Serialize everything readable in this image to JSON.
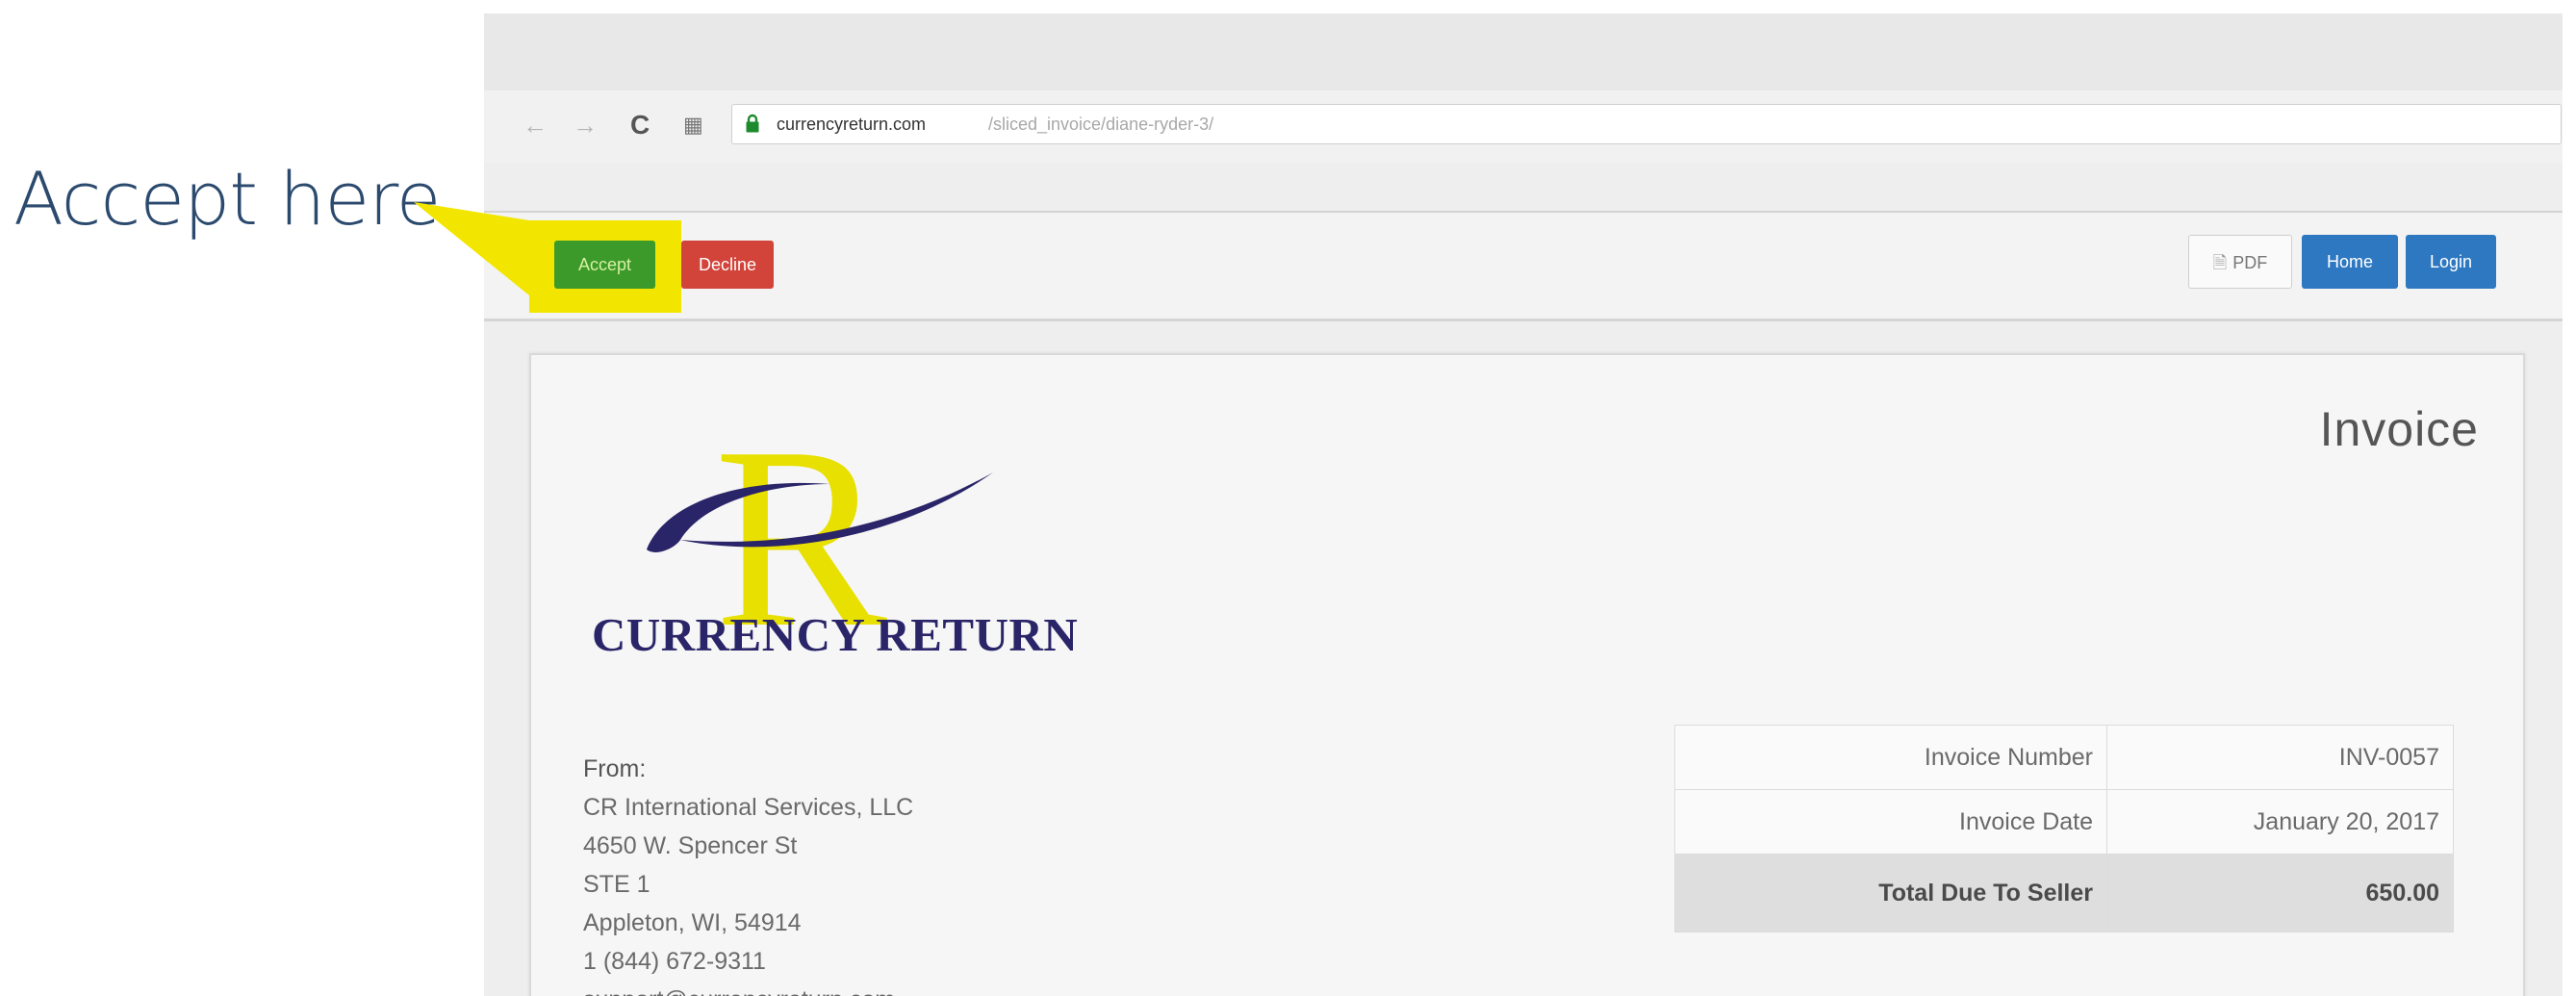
{
  "callout": {
    "text": "Accept here",
    "color": "#f2e600"
  },
  "browser": {
    "nav": {
      "back_icon": "back-arrow-icon",
      "forward_icon": "forward-arrow-icon",
      "reload_icon": "reload-icon",
      "apps_icon": "apps-grid-icon",
      "secure_icon": "lock-icon"
    },
    "url": {
      "host": "currencyreturn.com",
      "path": "/sliced_invoice/diane-ryder-3/"
    }
  },
  "actions": {
    "accept_label": "Accept",
    "decline_label": "Decline",
    "pdf_label": "PDF",
    "home_label": "Home",
    "login_label": "Login"
  },
  "invoice": {
    "title": "Invoice",
    "logo": {
      "wordmark": "CURRENCY RETURN",
      "brand_yellow": "#e8e000",
      "brand_navy": "#2a2468"
    },
    "from": {
      "label": "From:",
      "lines": [
        "CR International Services, LLC",
        "4650 W. Spencer St",
        "STE 1",
        "Appleton, WI, 54914",
        "1 (844) 672-9311",
        "support@currencyreturn.com"
      ]
    },
    "summary": [
      {
        "label": "Invoice Number",
        "value": "INV-0057"
      },
      {
        "label": "Invoice Date",
        "value": "January 20, 2017"
      },
      {
        "label": "Total Due To Seller",
        "value": "650.00"
      }
    ]
  },
  "colors": {
    "accept": "#3c9a2b",
    "decline": "#d2433a",
    "primary": "#2e78c2"
  }
}
